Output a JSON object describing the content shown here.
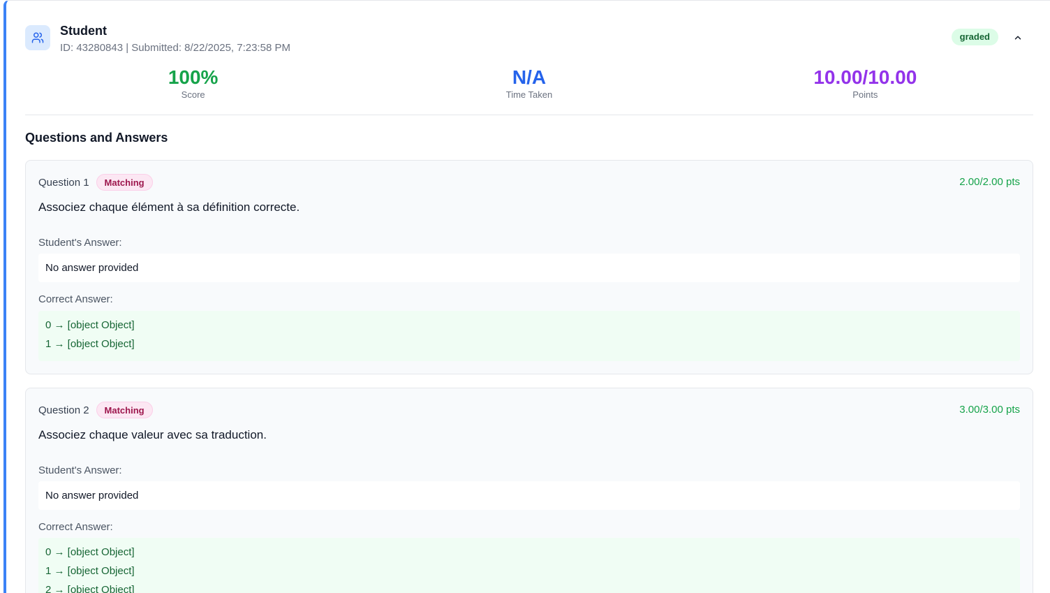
{
  "student": {
    "name": "Student",
    "meta": "ID: 43280843 | Submitted: 8/22/2025, 7:23:58 PM",
    "status": "graded"
  },
  "stats": [
    {
      "value": "100%",
      "label": "Score",
      "color": "#16a34a"
    },
    {
      "value": "N/A",
      "label": "Time Taken",
      "color": "#2563eb"
    },
    {
      "value": "10.00/10.00",
      "label": "Points",
      "color": "#9333ea"
    }
  ],
  "section_title": "Questions and Answers",
  "labels": {
    "student_answer": "Student's Answer:",
    "correct_answer": "Correct Answer:"
  },
  "questions": [
    {
      "number": "Question 1",
      "type": "Matching",
      "points": "2.00/2.00 pts",
      "text": "Associez chaque élément à sa définition correcte.",
      "student_answer": "No answer provided",
      "correct": [
        "0 → [object Object]",
        "1 → [object Object]"
      ]
    },
    {
      "number": "Question 2",
      "type": "Matching",
      "points": "3.00/3.00 pts",
      "text": "Associez chaque valeur avec sa traduction.",
      "student_answer": "No answer provided",
      "correct": [
        "0 → [object Object]",
        "1 → [object Object]",
        "2 → [object Object]"
      ]
    }
  ],
  "icons": {
    "avatar": "users-icon",
    "collapse": "chevron-up-icon"
  }
}
